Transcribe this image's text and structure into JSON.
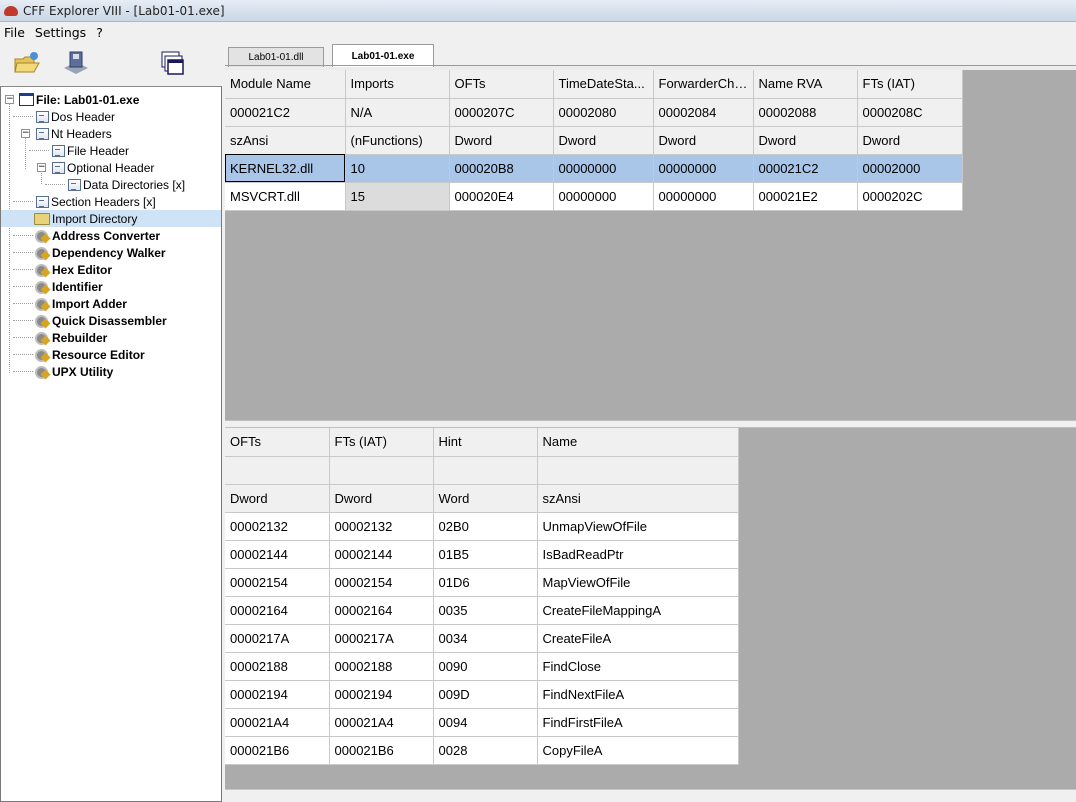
{
  "window": {
    "title": "CFF Explorer VIII - [Lab01-01.exe]"
  },
  "menu": [
    "File",
    "Settings",
    "?"
  ],
  "toolbar": {
    "icons": [
      "open-file-icon",
      "save-disk-icon",
      "windows-icon"
    ]
  },
  "tree": {
    "root": "File: Lab01-01.exe",
    "items": [
      "Dos Header",
      "Nt Headers",
      "File Header",
      "Optional Header",
      "Data Directories [x]",
      "Section Headers [x]",
      "Import Directory"
    ],
    "tools": [
      "Address Converter",
      "Dependency Walker",
      "Hex Editor",
      "Identifier",
      "Import Adder",
      "Quick Disassembler",
      "Rebuilder",
      "Resource Editor",
      "UPX Utility"
    ],
    "selected": "Import Directory"
  },
  "tabs": [
    "Lab01-01.dll",
    "Lab01-01.exe"
  ],
  "active_tab": "Lab01-01.exe",
  "modules_table": {
    "columns": [
      "Module Name",
      "Imports",
      "OFTs",
      "TimeDateSta...",
      "ForwarderCha...",
      "Name RVA",
      "FTs (IAT)"
    ],
    "offsets": [
      "000021C2",
      "N/A",
      "0000207C",
      "00002080",
      "00002084",
      "00002088",
      "0000208C"
    ],
    "types": [
      "szAnsi",
      "(nFunctions)",
      "Dword",
      "Dword",
      "Dword",
      "Dword",
      "Dword"
    ],
    "rows": [
      [
        "KERNEL32.dll",
        "10",
        "000020B8",
        "00000000",
        "00000000",
        "000021C2",
        "00002000"
      ],
      [
        "MSVCRT.dll",
        "15",
        "000020E4",
        "00000000",
        "00000000",
        "000021E2",
        "0000202C"
      ]
    ]
  },
  "functions_table": {
    "columns": [
      "OFTs",
      "FTs (IAT)",
      "Hint",
      "Name"
    ],
    "offsets": [
      "",
      "",
      "",
      ""
    ],
    "types": [
      "Dword",
      "Dword",
      "Word",
      "szAnsi"
    ],
    "rows": [
      [
        "00002132",
        "00002132",
        "02B0",
        "UnmapViewOfFile"
      ],
      [
        "00002144",
        "00002144",
        "01B5",
        "IsBadReadPtr"
      ],
      [
        "00002154",
        "00002154",
        "01D6",
        "MapViewOfFile"
      ],
      [
        "00002164",
        "00002164",
        "0035",
        "CreateFileMappingA"
      ],
      [
        "0000217A",
        "0000217A",
        "0034",
        "CreateFileA"
      ],
      [
        "00002188",
        "00002188",
        "0090",
        "FindClose"
      ],
      [
        "00002194",
        "00002194",
        "009D",
        "FindNextFileA"
      ],
      [
        "000021A4",
        "000021A4",
        "0094",
        "FindFirstFileA"
      ],
      [
        "000021B6",
        "000021B6",
        "0028",
        "CopyFileA"
      ]
    ]
  },
  "colors": {
    "selection": "#a9c5e8",
    "tree_selection": "#cfe3f7",
    "grid_background": "#ababab"
  }
}
